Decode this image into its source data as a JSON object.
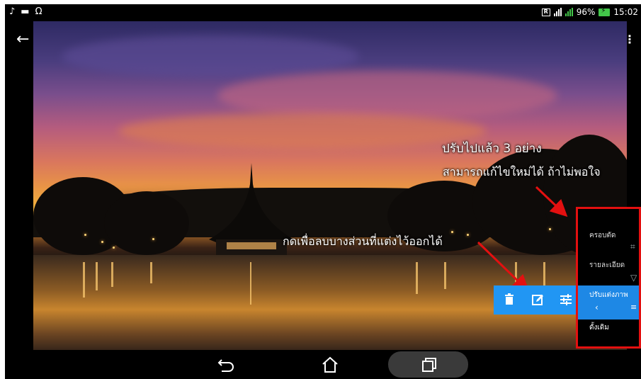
{
  "status_bar": {
    "left_icons": [
      "music-note-icon",
      "image-icon",
      "headphones-icon"
    ],
    "battery_percent": "96%",
    "time": "15:02"
  },
  "annotations": {
    "top_line1": "ปรับไปแล้ว 3 อย่าง",
    "top_line2": "สามารถแก้ไขใหม่ได้ ถ้าไม่พอใจ",
    "middle": "กดเพื่อลบบางส่วนที่แต่งไว้ออกได้"
  },
  "edit_panel": {
    "items": [
      {
        "label": "ครอบตัด",
        "icon": "crop-icon"
      },
      {
        "label": "รายละเอียด",
        "icon": "triangle-down-icon"
      },
      {
        "label": "ปรับแต่งภาพ",
        "icon": "tune-icon",
        "active": true
      },
      {
        "label": "ดั้งเดิม",
        "icon": ""
      }
    ]
  },
  "toolbar": {
    "buttons": [
      "delete-icon",
      "edit-icon",
      "tune-icon"
    ]
  },
  "colors": {
    "accent": "#2196f3",
    "annotation_red": "#e31010",
    "battery_green": "#43c64a"
  }
}
